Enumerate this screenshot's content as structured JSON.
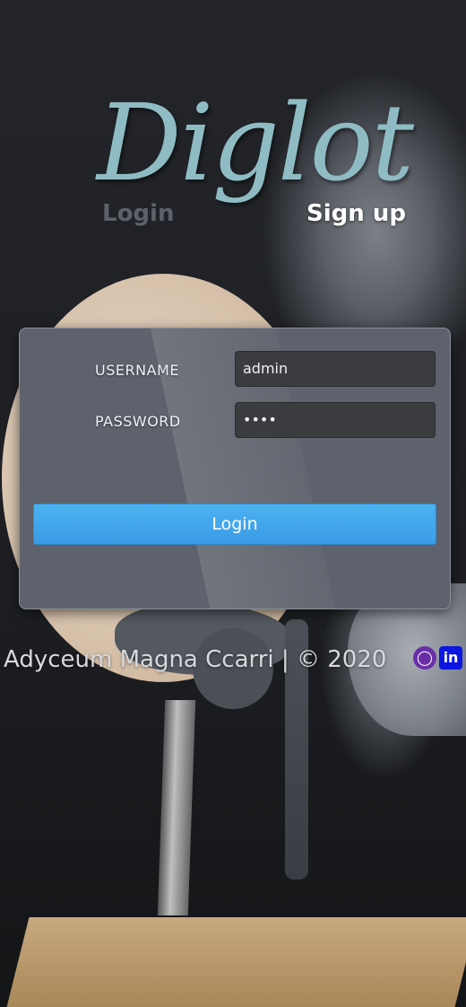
{
  "brand": {
    "logo_text": "Diglot"
  },
  "tabs": {
    "login": "Login",
    "signup": "Sign up"
  },
  "form": {
    "username_label": "USERNAME",
    "username_value": "admin",
    "password_label": "PASSWORD",
    "password_value": "••••",
    "submit_label": "Login"
  },
  "footer": {
    "text": "Adyceum Magna Ccarri | © 2020"
  },
  "social": {
    "github_icon": "github-icon",
    "linkedin_icon": "linkedin-icon",
    "github_glyph": "◯",
    "linkedin_glyph": "in"
  },
  "colors": {
    "accent": "#3a9ce6",
    "logo": "#8fbcc4",
    "linkedin": "#0b16e0",
    "github": "#6a2fa8"
  }
}
